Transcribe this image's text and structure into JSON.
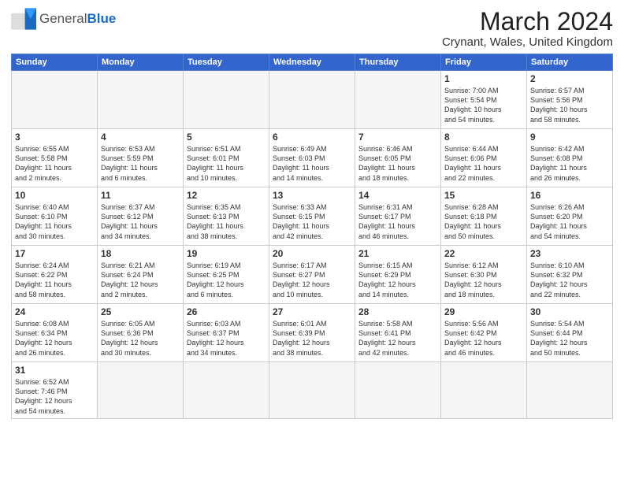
{
  "logo": {
    "text_general": "General",
    "text_blue": "Blue"
  },
  "title": "March 2024",
  "subtitle": "Crynant, Wales, United Kingdom",
  "days_of_week": [
    "Sunday",
    "Monday",
    "Tuesday",
    "Wednesday",
    "Thursday",
    "Friday",
    "Saturday"
  ],
  "weeks": [
    [
      {
        "day": "",
        "info": "",
        "empty": true
      },
      {
        "day": "",
        "info": "",
        "empty": true
      },
      {
        "day": "",
        "info": "",
        "empty": true
      },
      {
        "day": "",
        "info": "",
        "empty": true
      },
      {
        "day": "",
        "info": "",
        "empty": true
      },
      {
        "day": "1",
        "info": "Sunrise: 7:00 AM\nSunset: 5:54 PM\nDaylight: 10 hours\nand 54 minutes."
      },
      {
        "day": "2",
        "info": "Sunrise: 6:57 AM\nSunset: 5:56 PM\nDaylight: 10 hours\nand 58 minutes."
      }
    ],
    [
      {
        "day": "3",
        "info": "Sunrise: 6:55 AM\nSunset: 5:58 PM\nDaylight: 11 hours\nand 2 minutes."
      },
      {
        "day": "4",
        "info": "Sunrise: 6:53 AM\nSunset: 5:59 PM\nDaylight: 11 hours\nand 6 minutes."
      },
      {
        "day": "5",
        "info": "Sunrise: 6:51 AM\nSunset: 6:01 PM\nDaylight: 11 hours\nand 10 minutes."
      },
      {
        "day": "6",
        "info": "Sunrise: 6:49 AM\nSunset: 6:03 PM\nDaylight: 11 hours\nand 14 minutes."
      },
      {
        "day": "7",
        "info": "Sunrise: 6:46 AM\nSunset: 6:05 PM\nDaylight: 11 hours\nand 18 minutes."
      },
      {
        "day": "8",
        "info": "Sunrise: 6:44 AM\nSunset: 6:06 PM\nDaylight: 11 hours\nand 22 minutes."
      },
      {
        "day": "9",
        "info": "Sunrise: 6:42 AM\nSunset: 6:08 PM\nDaylight: 11 hours\nand 26 minutes."
      }
    ],
    [
      {
        "day": "10",
        "info": "Sunrise: 6:40 AM\nSunset: 6:10 PM\nDaylight: 11 hours\nand 30 minutes."
      },
      {
        "day": "11",
        "info": "Sunrise: 6:37 AM\nSunset: 6:12 PM\nDaylight: 11 hours\nand 34 minutes."
      },
      {
        "day": "12",
        "info": "Sunrise: 6:35 AM\nSunset: 6:13 PM\nDaylight: 11 hours\nand 38 minutes."
      },
      {
        "day": "13",
        "info": "Sunrise: 6:33 AM\nSunset: 6:15 PM\nDaylight: 11 hours\nand 42 minutes."
      },
      {
        "day": "14",
        "info": "Sunrise: 6:31 AM\nSunset: 6:17 PM\nDaylight: 11 hours\nand 46 minutes."
      },
      {
        "day": "15",
        "info": "Sunrise: 6:28 AM\nSunset: 6:18 PM\nDaylight: 11 hours\nand 50 minutes."
      },
      {
        "day": "16",
        "info": "Sunrise: 6:26 AM\nSunset: 6:20 PM\nDaylight: 11 hours\nand 54 minutes."
      }
    ],
    [
      {
        "day": "17",
        "info": "Sunrise: 6:24 AM\nSunset: 6:22 PM\nDaylight: 11 hours\nand 58 minutes."
      },
      {
        "day": "18",
        "info": "Sunrise: 6:21 AM\nSunset: 6:24 PM\nDaylight: 12 hours\nand 2 minutes."
      },
      {
        "day": "19",
        "info": "Sunrise: 6:19 AM\nSunset: 6:25 PM\nDaylight: 12 hours\nand 6 minutes."
      },
      {
        "day": "20",
        "info": "Sunrise: 6:17 AM\nSunset: 6:27 PM\nDaylight: 12 hours\nand 10 minutes."
      },
      {
        "day": "21",
        "info": "Sunrise: 6:15 AM\nSunset: 6:29 PM\nDaylight: 12 hours\nand 14 minutes."
      },
      {
        "day": "22",
        "info": "Sunrise: 6:12 AM\nSunset: 6:30 PM\nDaylight: 12 hours\nand 18 minutes."
      },
      {
        "day": "23",
        "info": "Sunrise: 6:10 AM\nSunset: 6:32 PM\nDaylight: 12 hours\nand 22 minutes."
      }
    ],
    [
      {
        "day": "24",
        "info": "Sunrise: 6:08 AM\nSunset: 6:34 PM\nDaylight: 12 hours\nand 26 minutes."
      },
      {
        "day": "25",
        "info": "Sunrise: 6:05 AM\nSunset: 6:36 PM\nDaylight: 12 hours\nand 30 minutes."
      },
      {
        "day": "26",
        "info": "Sunrise: 6:03 AM\nSunset: 6:37 PM\nDaylight: 12 hours\nand 34 minutes."
      },
      {
        "day": "27",
        "info": "Sunrise: 6:01 AM\nSunset: 6:39 PM\nDaylight: 12 hours\nand 38 minutes."
      },
      {
        "day": "28",
        "info": "Sunrise: 5:58 AM\nSunset: 6:41 PM\nDaylight: 12 hours\nand 42 minutes."
      },
      {
        "day": "29",
        "info": "Sunrise: 5:56 AM\nSunset: 6:42 PM\nDaylight: 12 hours\nand 46 minutes."
      },
      {
        "day": "30",
        "info": "Sunrise: 5:54 AM\nSunset: 6:44 PM\nDaylight: 12 hours\nand 50 minutes."
      }
    ],
    [
      {
        "day": "31",
        "info": "Sunrise: 6:52 AM\nSunset: 7:46 PM\nDaylight: 12 hours\nand 54 minutes.",
        "last": true
      },
      {
        "day": "",
        "info": "",
        "empty": true,
        "last": true
      },
      {
        "day": "",
        "info": "",
        "empty": true,
        "last": true
      },
      {
        "day": "",
        "info": "",
        "empty": true,
        "last": true
      },
      {
        "day": "",
        "info": "",
        "empty": true,
        "last": true
      },
      {
        "day": "",
        "info": "",
        "empty": true,
        "last": true
      },
      {
        "day": "",
        "info": "",
        "empty": true,
        "last": true
      }
    ]
  ]
}
